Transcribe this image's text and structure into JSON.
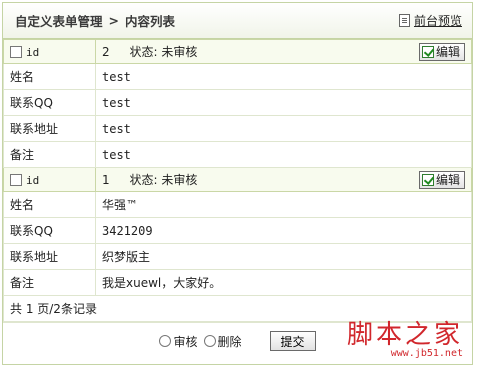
{
  "header": {
    "crumb_1": "自定义表单管理",
    "crumb_sep": ">",
    "crumb_2": "内容列表",
    "preview_label": "前台预览"
  },
  "records": [
    {
      "id_label": "id",
      "id_value": "2",
      "status": "状态: 未审核",
      "edit_label": "编辑",
      "fields": [
        {
          "label": "姓名",
          "value": "test"
        },
        {
          "label": "联系QQ",
          "value": "test"
        },
        {
          "label": "联系地址",
          "value": "test"
        },
        {
          "label": "备注",
          "value": "test"
        }
      ]
    },
    {
      "id_label": "id",
      "id_value": "1",
      "status": "状态: 未审核",
      "edit_label": "编辑",
      "fields": [
        {
          "label": "姓名",
          "value": "华强™"
        },
        {
          "label": "联系QQ",
          "value": "3421209"
        },
        {
          "label": "联系地址",
          "value": "织梦版主"
        },
        {
          "label": "备注",
          "value": "我是xuewl，大家好。"
        }
      ]
    }
  ],
  "summary": "共 1 页/2条记录",
  "footer": {
    "radio_approve": "审核",
    "radio_delete": "删除",
    "submit_label": "提交"
  },
  "watermark": {
    "text": "脚本之家",
    "url": "www.jb51.net"
  },
  "colors": {
    "border": "#c5d4a5",
    "header_row_bg": "#f8fbee",
    "watermark": "#d1272c"
  }
}
